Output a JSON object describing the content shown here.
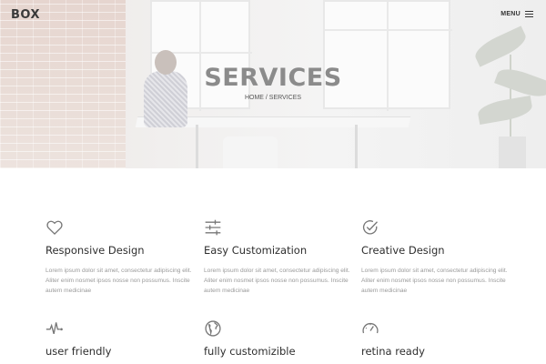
{
  "header": {
    "logo": "BOX",
    "menu_label": "MENU"
  },
  "hero": {
    "title": "SERVICES",
    "breadcrumb": "HOME / SERVICES"
  },
  "features": [
    {
      "icon": "heart-icon",
      "title": "Responsive Design",
      "text": "Lorem ipsum dolor sit amet, consectetur adipiscing elit. Aliter enim nosmet ipsos nosse non possumus. Inscite autem medicinae"
    },
    {
      "icon": "sliders-icon",
      "title": "Easy Customization",
      "text": "Lorem ipsum dolor sit amet, consectetur adipiscing elit. Aliter enim nosmet ipsos nosse non possumus. Inscite autem medicinae"
    },
    {
      "icon": "check-circle-icon",
      "title": "Creative Design",
      "text": "Lorem ipsum dolor sit amet, consectetur adipiscing elit. Aliter enim nosmet ipsos nosse non possumus. Inscite autem medicinae"
    },
    {
      "icon": "pulse-icon",
      "title": "user friendly",
      "text": ""
    },
    {
      "icon": "globe-icon",
      "title": "fully customizible",
      "text": ""
    },
    {
      "icon": "speedometer-icon",
      "title": "retina ready",
      "text": ""
    }
  ]
}
